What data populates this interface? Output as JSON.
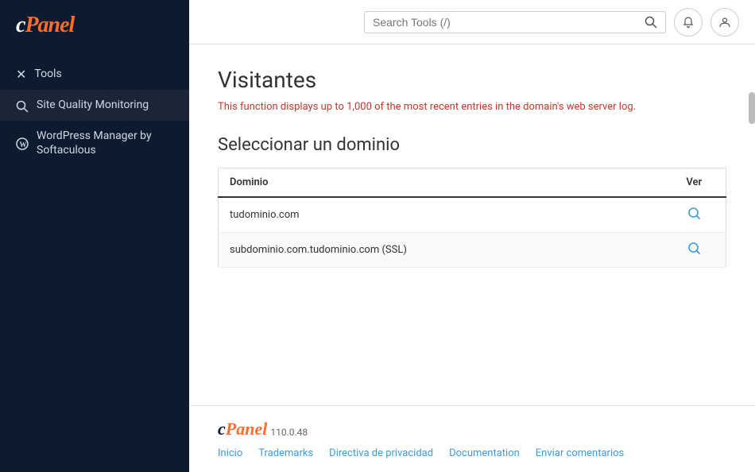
{
  "sidebar": {
    "logo": "cPanel",
    "items": [
      {
        "id": "tools",
        "label": "Tools",
        "icon": "✕"
      },
      {
        "id": "site-quality",
        "label": "Site Quality Monitoring",
        "icon": "🔍"
      },
      {
        "id": "wordpress",
        "label": "WordPress Manager by Softaculous",
        "icon": "Ⓦ"
      }
    ]
  },
  "header": {
    "search_placeholder": "Search Tools (/)",
    "search_button_icon": "🔍",
    "notifications_icon": "🔔",
    "user_icon": "👤"
  },
  "page": {
    "title": "Visitantes",
    "description": "This function displays up to 1,000 of the most recent entries in the domain's web server log.",
    "section_title": "Seleccionar un dominio",
    "table": {
      "col_domain": "Dominio",
      "col_view": "Ver",
      "rows": [
        {
          "domain": "tudominio.com",
          "ssl": false
        },
        {
          "domain": "subdominio.com.tudominio.com (SSL)",
          "ssl": true
        }
      ]
    }
  },
  "footer": {
    "logo": "cPanel",
    "version": "110.0.48",
    "links": [
      {
        "label": "Inicio"
      },
      {
        "label": "Trademarks"
      },
      {
        "label": "Directiva de privacidad"
      },
      {
        "label": "Documentation"
      },
      {
        "label": "Enviar comentarios"
      }
    ]
  }
}
